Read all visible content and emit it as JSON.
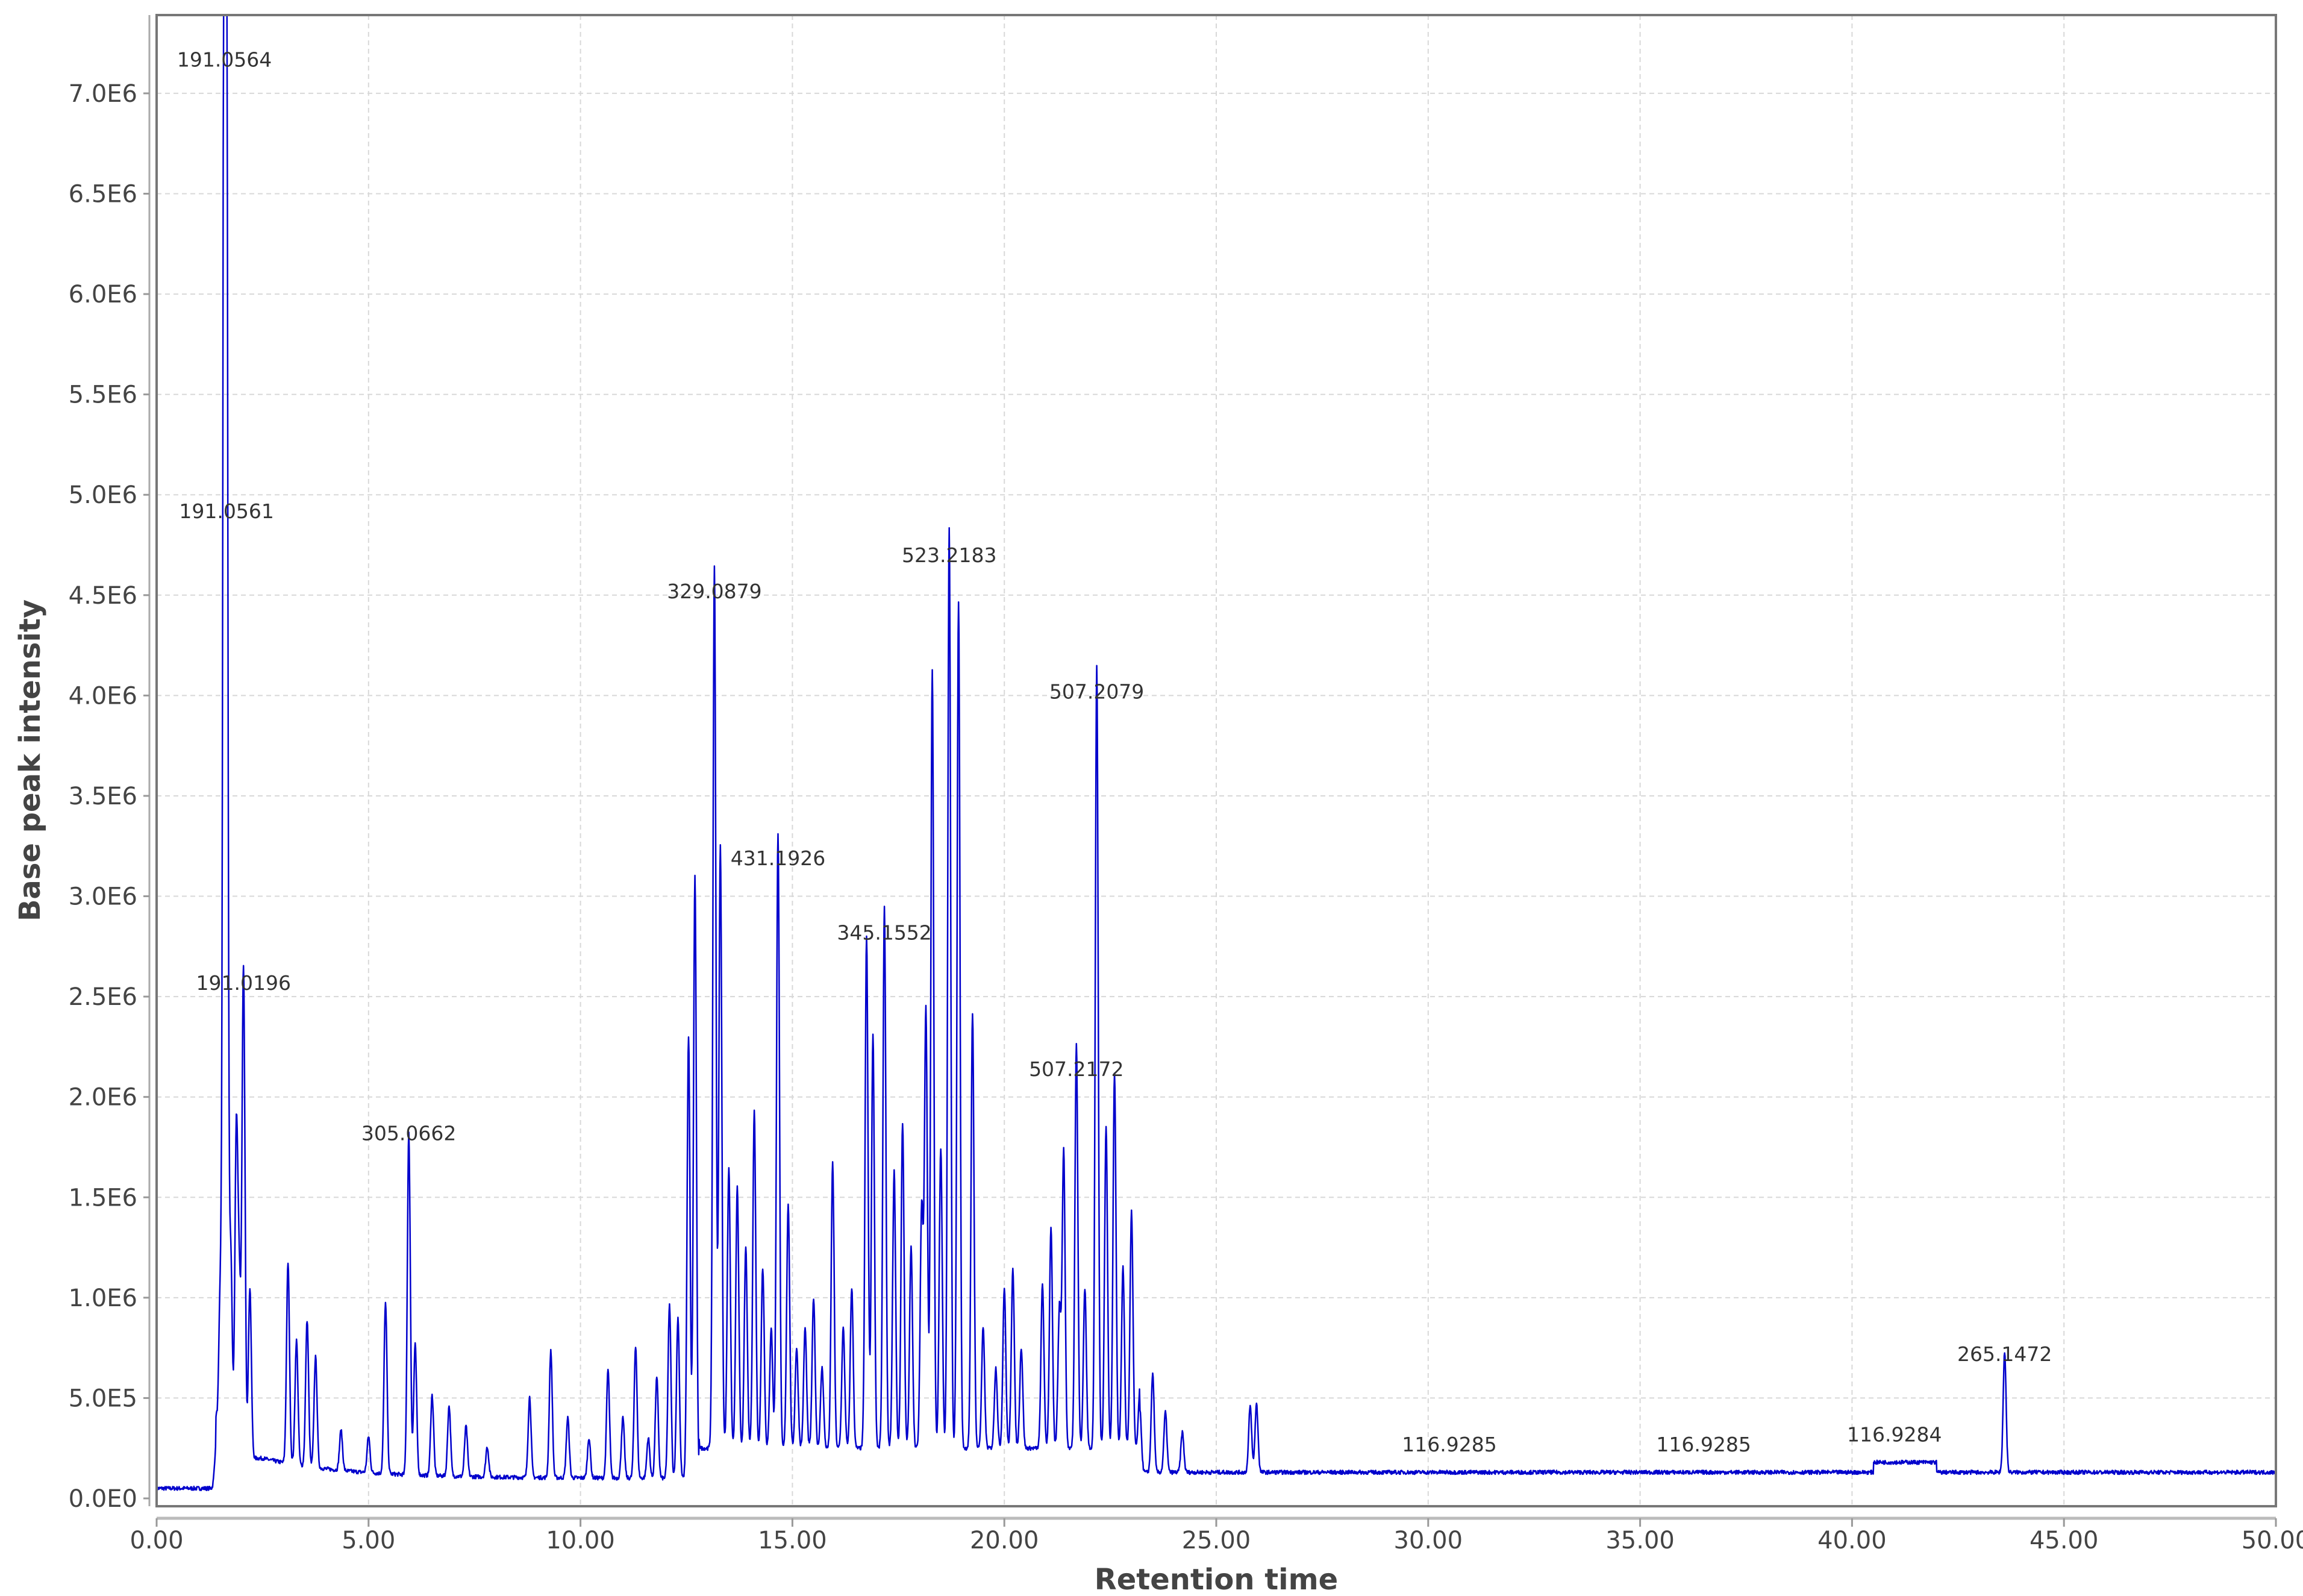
{
  "chart_data": {
    "type": "line",
    "title": "",
    "xlabel": "Retention time",
    "ylabel": "Base peak intensity",
    "xlim": [
      0,
      50
    ],
    "ylim": [
      0,
      7390000
    ],
    "grid": true,
    "line_color": "#0000cc",
    "x_ticks": [
      {
        "value": 0,
        "label": "0.00"
      },
      {
        "value": 5,
        "label": "5.00"
      },
      {
        "value": 10,
        "label": "10.00"
      },
      {
        "value": 15,
        "label": "15.00"
      },
      {
        "value": 20,
        "label": "20.00"
      },
      {
        "value": 25,
        "label": "25.00"
      },
      {
        "value": 30,
        "label": "30.00"
      },
      {
        "value": 35,
        "label": "35.00"
      },
      {
        "value": 40,
        "label": "40.00"
      },
      {
        "value": 45,
        "label": "45.00"
      },
      {
        "value": 50,
        "label": "50.00"
      }
    ],
    "y_ticks": [
      {
        "value": 0,
        "label": "0.0E0"
      },
      {
        "value": 500000,
        "label": "5.0E5"
      },
      {
        "value": 1000000,
        "label": "1.0E6"
      },
      {
        "value": 1500000,
        "label": "1.5E6"
      },
      {
        "value": 2000000,
        "label": "2.0E6"
      },
      {
        "value": 2500000,
        "label": "2.5E6"
      },
      {
        "value": 3000000,
        "label": "3.0E6"
      },
      {
        "value": 3500000,
        "label": "3.5E6"
      },
      {
        "value": 4000000,
        "label": "4.0E6"
      },
      {
        "value": 4500000,
        "label": "4.5E6"
      },
      {
        "value": 5000000,
        "label": "5.0E6"
      },
      {
        "value": 5500000,
        "label": "5.5E6"
      },
      {
        "value": 6000000,
        "label": "6.0E6"
      },
      {
        "value": 6500000,
        "label": "6.5E6"
      },
      {
        "value": 7000000,
        "label": "7.0E6"
      }
    ],
    "annotations": [
      {
        "label": "191.0564",
        "rt": 1.6,
        "intensity": 7050000
      },
      {
        "label": "191.0561",
        "rt": 1.65,
        "intensity": 4800000
      },
      {
        "label": "191.0196",
        "rt": 2.05,
        "intensity": 2450000
      },
      {
        "label": "305.0662",
        "rt": 5.95,
        "intensity": 1700000
      },
      {
        "label": "329.0879",
        "rt": 13.16,
        "intensity": 4400000
      },
      {
        "label": "431.1926",
        "rt": 14.66,
        "intensity": 3070000
      },
      {
        "label": "345.1552",
        "rt": 17.17,
        "intensity": 2700000
      },
      {
        "label": "523.2183",
        "rt": 18.7,
        "intensity": 4580000
      },
      {
        "label": "507.2172",
        "rt": 21.7,
        "intensity": 2020000
      },
      {
        "label": "507.2079",
        "rt": 22.18,
        "intensity": 3900000
      },
      {
        "label": "116.9285",
        "rt": 30.5,
        "intensity": 150000
      },
      {
        "label": "116.9285",
        "rt": 36.5,
        "intensity": 150000
      },
      {
        "label": "116.9284",
        "rt": 41.0,
        "intensity": 200000
      },
      {
        "label": "265.1472",
        "rt": 43.6,
        "intensity": 600000
      }
    ],
    "peaks": [
      [
        1.4,
        0.2
      ],
      [
        1.5,
        0.8
      ],
      [
        1.6,
        7.05
      ],
      [
        1.65,
        4.8
      ],
      [
        1.62,
        3.2
      ],
      [
        1.75,
        1.0
      ],
      [
        1.88,
        1.6
      ],
      [
        1.95,
        0.8
      ],
      [
        2.05,
        2.45
      ],
      [
        2.2,
        0.85
      ],
      [
        3.1,
        1.0
      ],
      [
        3.3,
        0.62
      ],
      [
        3.55,
        0.73
      ],
      [
        3.75,
        0.55
      ],
      [
        4.35,
        0.2
      ],
      [
        5.0,
        0.18
      ],
      [
        5.4,
        0.85
      ],
      [
        5.95,
        1.7
      ],
      [
        6.1,
        0.65
      ],
      [
        6.5,
        0.4
      ],
      [
        6.9,
        0.35
      ],
      [
        7.3,
        0.25
      ],
      [
        7.8,
        0.15
      ],
      [
        8.8,
        0.4
      ],
      [
        9.3,
        0.63
      ],
      [
        9.7,
        0.3
      ],
      [
        10.2,
        0.2
      ],
      [
        10.65,
        0.54
      ],
      [
        11.0,
        0.3
      ],
      [
        11.3,
        0.66
      ],
      [
        11.6,
        0.2
      ],
      [
        11.8,
        0.5
      ],
      [
        12.1,
        0.86
      ],
      [
        12.3,
        0.8
      ],
      [
        12.55,
        2.2
      ],
      [
        12.7,
        3.0
      ],
      [
        13.16,
        4.4
      ],
      [
        13.3,
        3.0
      ],
      [
        13.5,
        1.4
      ],
      [
        13.7,
        1.3
      ],
      [
        13.9,
        1.0
      ],
      [
        14.1,
        1.68
      ],
      [
        14.3,
        0.9
      ],
      [
        14.5,
        0.6
      ],
      [
        14.66,
        3.07
      ],
      [
        14.9,
        1.22
      ],
      [
        15.1,
        0.5
      ],
      [
        15.3,
        0.6
      ],
      [
        15.5,
        0.75
      ],
      [
        15.7,
        0.4
      ],
      [
        15.95,
        1.42
      ],
      [
        16.2,
        0.6
      ],
      [
        16.4,
        0.8
      ],
      [
        16.75,
        2.55
      ],
      [
        16.9,
        2.06
      ],
      [
        17.17,
        2.7
      ],
      [
        17.4,
        1.38
      ],
      [
        17.6,
        1.62
      ],
      [
        17.8,
        1.0
      ],
      [
        18.05,
        1.2
      ],
      [
        18.15,
        2.18
      ],
      [
        18.3,
        3.88
      ],
      [
        18.5,
        1.5
      ],
      [
        18.7,
        4.58
      ],
      [
        18.92,
        4.22
      ],
      [
        19.25,
        2.17
      ],
      [
        19.5,
        0.6
      ],
      [
        19.8,
        0.4
      ],
      [
        20.0,
        0.8
      ],
      [
        20.2,
        0.9
      ],
      [
        20.4,
        0.5
      ],
      [
        20.9,
        0.82
      ],
      [
        21.1,
        1.1
      ],
      [
        21.3,
        0.7
      ],
      [
        21.4,
        1.48
      ],
      [
        21.7,
        2.02
      ],
      [
        21.9,
        0.8
      ],
      [
        22.18,
        3.9
      ],
      [
        22.4,
        1.6
      ],
      [
        22.6,
        1.87
      ],
      [
        22.8,
        0.9
      ],
      [
        23.0,
        1.18
      ],
      [
        23.2,
        0.3
      ],
      [
        23.5,
        0.49
      ],
      [
        23.8,
        0.3
      ],
      [
        24.2,
        0.2
      ],
      [
        25.8,
        0.33
      ],
      [
        25.95,
        0.34
      ],
      [
        43.6,
        0.6
      ]
    ],
    "peak_intensity_unit": "E6"
  }
}
